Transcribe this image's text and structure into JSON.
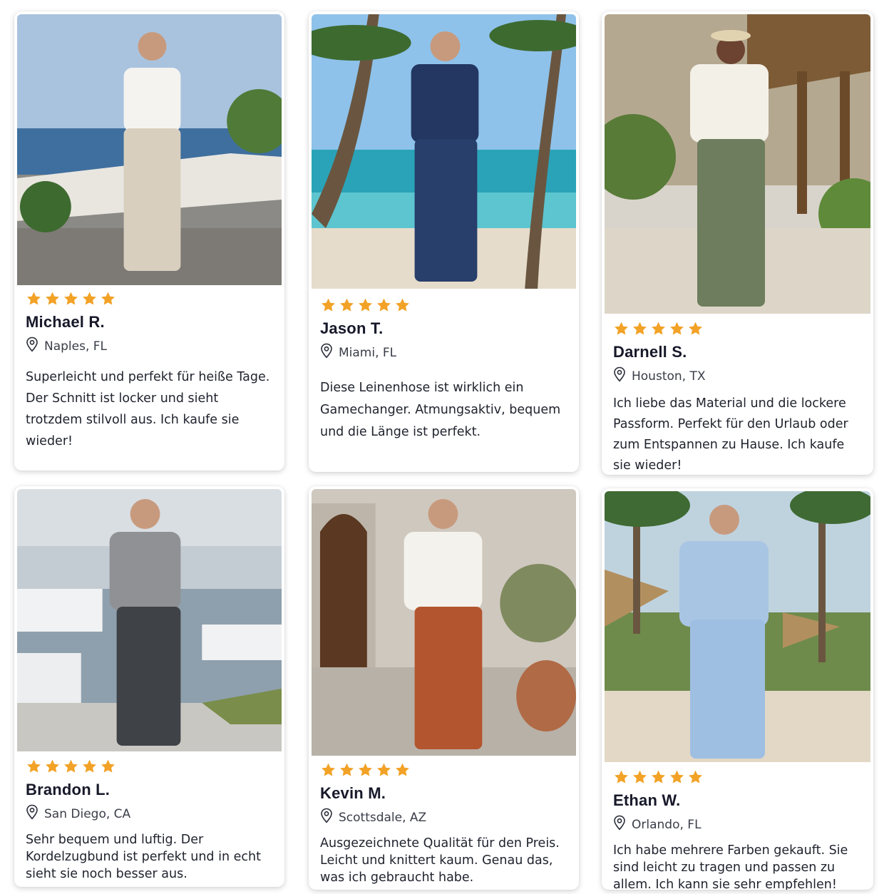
{
  "colors": {
    "star": "#f2a226",
    "text": "#1b1e2b",
    "muted": "#3a3d48"
  },
  "rating_icon": "star-icon",
  "location_icon": "map-pin-icon",
  "reviews": [
    {
      "name": "Michael R.",
      "location": "Naples, FL",
      "stars": 5,
      "text": "Superleicht und perfekt für heiße Tage. Der Schnitt ist locker und sieht trotzdem stilvoll aus. Ich kaufe sie wieder!"
    },
    {
      "name": "Jason T.",
      "location": "Miami, FL",
      "stars": 5,
      "text": "Diese Leinenhose ist wirklich ein Gamechanger. Atmungsaktiv, bequem und die Länge ist perfekt."
    },
    {
      "name": "Darnell S.",
      "location": "Houston, TX",
      "stars": 5,
      "text": "Ich liebe das Material und die lockere Passform. Perfekt für den Urlaub oder zum Entspannen zu Hause. Ich kaufe sie wieder!"
    },
    {
      "name": "Brandon L.",
      "location": "San Diego, CA",
      "stars": 5,
      "text": "Sehr bequem und luftig. Der Kordelzugbund ist perfekt und in echt sieht sie noch besser aus."
    },
    {
      "name": "Kevin M.",
      "location": "Scottsdale, AZ",
      "stars": 5,
      "text": "Ausgezeichnete Qualität für den Preis. Leicht und knittert kaum. Genau das, was ich gebraucht habe."
    },
    {
      "name": "Ethan W.",
      "location": "Orlando, FL",
      "stars": 5,
      "text": "Ich habe mehrere Farben gekauft. Sie sind leicht zu tragen und passen zu allem. Ich kann sie sehr empfehlen!"
    }
  ]
}
